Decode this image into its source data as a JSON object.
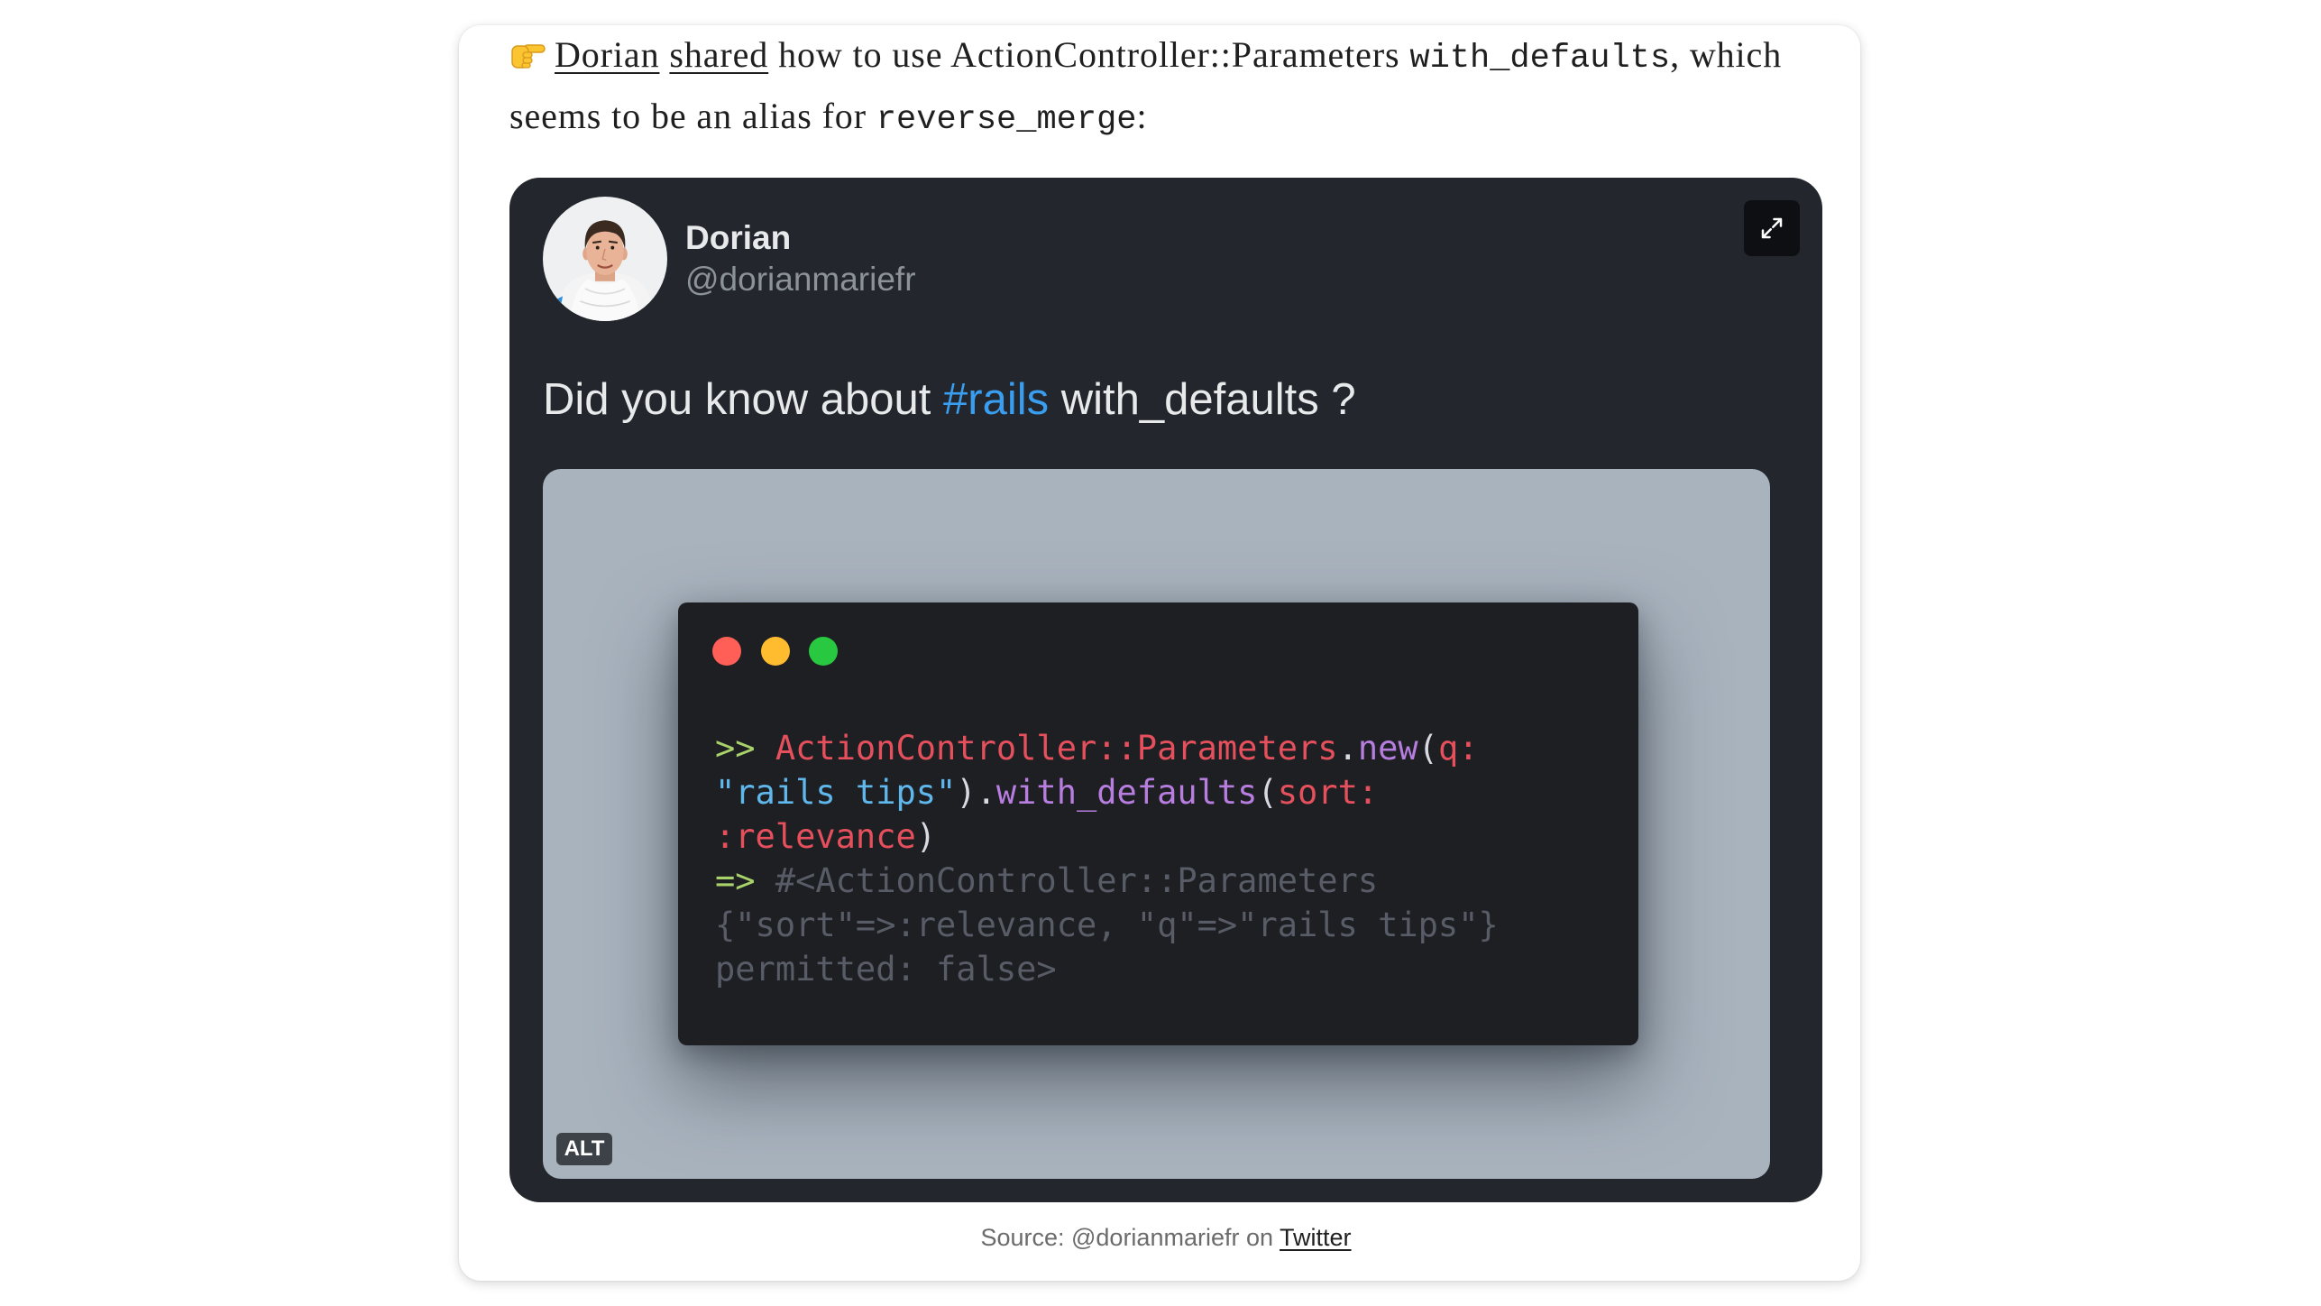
{
  "post": {
    "emoji_icon": "point-right-icon",
    "author_link": "Dorian",
    "shared_link": "shared",
    "text_1": " how to use ActionController::Parameters ",
    "code_1": "with_defaults",
    "text_2": ", which",
    "text_3": "seems to be an alias for ",
    "code_2": "reverse_merge",
    "text_4": ":"
  },
  "tweet": {
    "avatar_icon": "avatar",
    "name": "Dorian",
    "handle": "@dorianmariefr",
    "expand_icon": "expand-icon",
    "text_before": "Did you know about ",
    "hashtag": "#rails",
    "text_after": " with_defaults ?",
    "alt_badge": "ALT"
  },
  "code": {
    "colors": {
      "prompt": "#a8d26a",
      "const": "#e5505c",
      "punct": "#d7dae0",
      "method": "#b77ddf",
      "symbol": "#e5505c",
      "string": "#5fb7ec",
      "comment": "#575c66"
    },
    "lines": [
      [
        {
          "t": ">> ",
          "k": "prompt"
        },
        {
          "t": "ActionController::Parameters",
          "k": "const"
        },
        {
          "t": ".",
          "k": "punct"
        },
        {
          "t": "new",
          "k": "method"
        },
        {
          "t": "(",
          "k": "punct"
        },
        {
          "t": "q:",
          "k": "symbol"
        }
      ],
      [
        {
          "t": "\"rails tips\"",
          "k": "string"
        },
        {
          "t": ")",
          "k": "punct"
        },
        {
          "t": ".",
          "k": "punct"
        },
        {
          "t": "with_defaults",
          "k": "method"
        },
        {
          "t": "(",
          "k": "punct"
        },
        {
          "t": "sort:",
          "k": "symbol"
        }
      ],
      [
        {
          "t": ":relevance",
          "k": "symbol"
        },
        {
          "t": ")",
          "k": "punct"
        }
      ],
      [
        {
          "t": "=> ",
          "k": "prompt"
        },
        {
          "t": "#<ActionController::Parameters",
          "k": "comment"
        }
      ],
      [
        {
          "t": "{\"sort\"=>:relevance, \"q\"=>\"rails tips\"}",
          "k": "comment"
        }
      ],
      [
        {
          "t": "permitted: false>",
          "k": "comment"
        }
      ]
    ]
  },
  "caption": {
    "prefix": "Source: @dorianmariefr on ",
    "link": "Twitter"
  },
  "colors": {
    "tweet_background": "#23262c",
    "hashtag": "#3a9ef0",
    "media_background": "#a9b3be",
    "code_background": "#1e1f23",
    "window_buttons": [
      "#ff5f57",
      "#febc2e",
      "#28c840"
    ]
  }
}
